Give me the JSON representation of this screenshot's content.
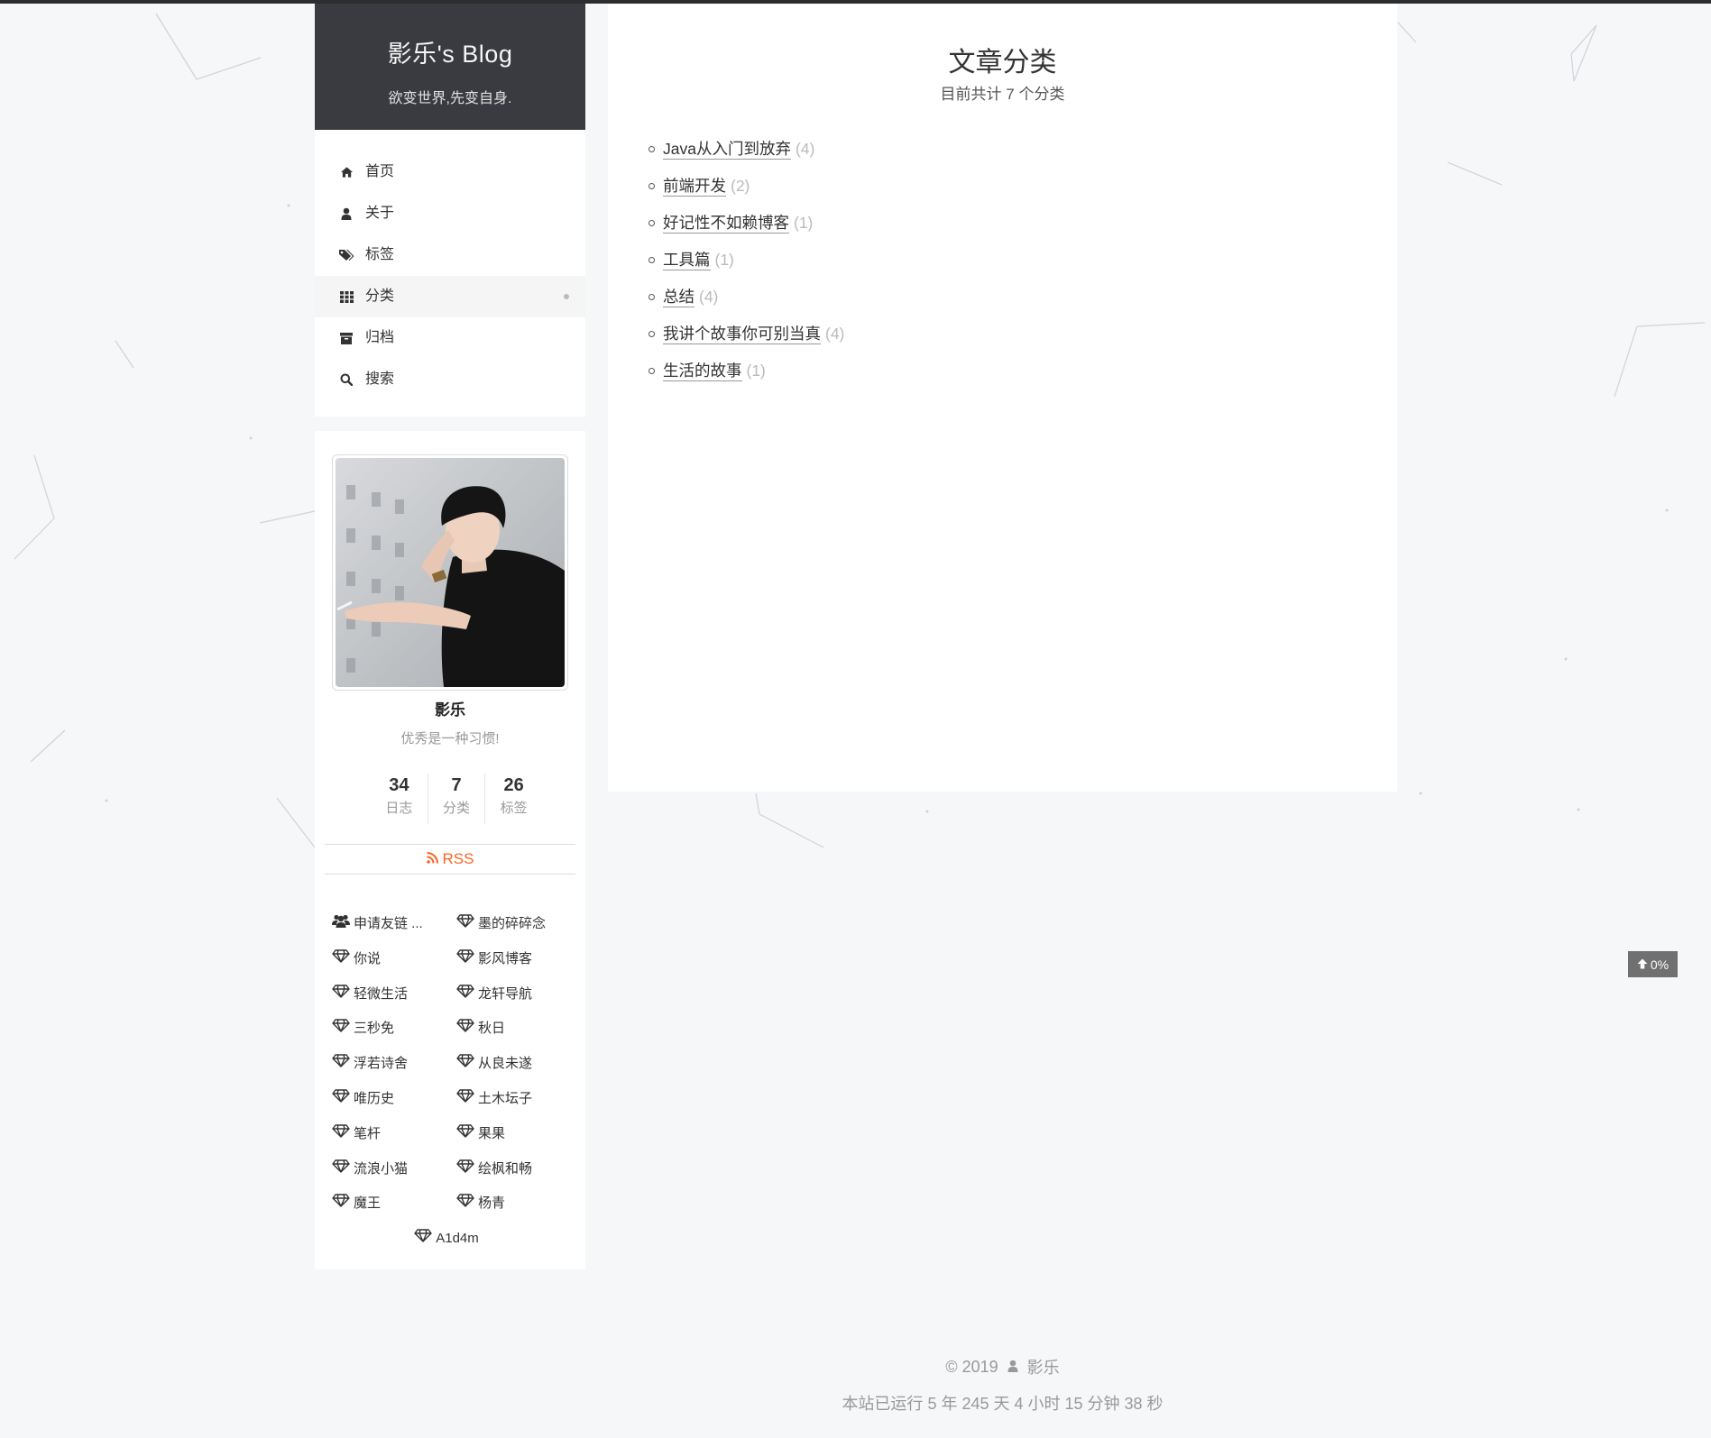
{
  "site": {
    "title": "影乐's Blog",
    "subtitle": "欲变世界,先变自身."
  },
  "menu": {
    "items": [
      {
        "label": "首页",
        "icon": "home-icon"
      },
      {
        "label": "关于",
        "icon": "user-icon"
      },
      {
        "label": "标签",
        "icon": "tags-icon"
      },
      {
        "label": "分类",
        "icon": "grid-icon",
        "active": true
      },
      {
        "label": "归档",
        "icon": "archive-icon"
      },
      {
        "label": "搜索",
        "icon": "search-icon"
      }
    ]
  },
  "profile": {
    "name": "影乐",
    "motto": "优秀是一种习惯!",
    "stats": [
      {
        "count": "34",
        "label": "日志"
      },
      {
        "count": "7",
        "label": "分类"
      },
      {
        "count": "26",
        "label": "标签"
      }
    ],
    "rss_label": "RSS",
    "rss_color": "#fc6423"
  },
  "links": [
    {
      "label": "申请友链 ...",
      "icon": "users-icon"
    },
    {
      "label": "墨的碎碎念",
      "icon": "diamond-icon"
    },
    {
      "label": "你说",
      "icon": "diamond-icon"
    },
    {
      "label": "影风博客",
      "icon": "diamond-icon"
    },
    {
      "label": "轻微生活",
      "icon": "diamond-icon"
    },
    {
      "label": "龙轩导航",
      "icon": "diamond-icon"
    },
    {
      "label": "三秒免",
      "icon": "diamond-icon"
    },
    {
      "label": "秋日",
      "icon": "diamond-icon"
    },
    {
      "label": "浮若诗舍",
      "icon": "diamond-icon"
    },
    {
      "label": "从良未遂",
      "icon": "diamond-icon"
    },
    {
      "label": "唯历史",
      "icon": "diamond-icon"
    },
    {
      "label": "土木坛子",
      "icon": "diamond-icon"
    },
    {
      "label": "笔杆",
      "icon": "diamond-icon"
    },
    {
      "label": "果果",
      "icon": "diamond-icon"
    },
    {
      "label": "流浪小猫",
      "icon": "diamond-icon"
    },
    {
      "label": "绘枫和畅",
      "icon": "diamond-icon"
    },
    {
      "label": "魔王",
      "icon": "diamond-icon"
    },
    {
      "label": "杨青",
      "icon": "diamond-icon"
    },
    {
      "label": "A1d4m",
      "icon": "diamond-icon"
    }
  ],
  "main": {
    "title": "文章分类",
    "subtitle": "目前共计 7 个分类",
    "categories": [
      {
        "name": "Java从入门到放弃",
        "count": "(4)"
      },
      {
        "name": "前端开发",
        "count": "(2)"
      },
      {
        "name": "好记性不如赖博客",
        "count": "(1)"
      },
      {
        "name": "工具篇",
        "count": "(1)"
      },
      {
        "name": "总结",
        "count": "(4)"
      },
      {
        "name": "我讲个故事你可别当真",
        "count": "(4)"
      },
      {
        "name": "生活的故事",
        "count": "(1)"
      }
    ]
  },
  "back_to_top": {
    "label": "0%",
    "icon": "arrow-up-icon"
  },
  "footer": {
    "copyright": "© 2019",
    "author": "影乐",
    "uptime": "本站已运行 5 年 245 天 4 小时 15 分钟 38 秒"
  }
}
